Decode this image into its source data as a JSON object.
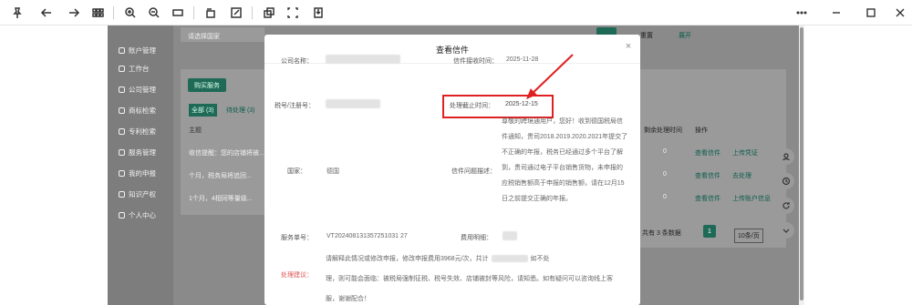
{
  "toolbar": {
    "icons": [
      "pin-icon",
      "back-icon",
      "forward-icon",
      "grid-icon",
      "zoom-in-icon",
      "zoom-out-icon",
      "fit-icon",
      "rotate-icon",
      "edit-icon",
      "copy-icon",
      "select-icon",
      "save-icon"
    ],
    "window_controls": [
      "more-icon",
      "minimize-icon",
      "maximize-icon",
      "close-icon"
    ]
  },
  "sidebar": {
    "items": [
      {
        "label": "账户管理"
      },
      {
        "label": "工作台"
      },
      {
        "label": "公司管理"
      },
      {
        "label": "商标检索"
      },
      {
        "label": "专利检索"
      },
      {
        "label": "服务管理"
      },
      {
        "label": "我的申报"
      },
      {
        "label": "知识产权"
      },
      {
        "label": "个人中心"
      }
    ]
  },
  "background": {
    "search_placeholder": "请选择国家",
    "reset_label": "重置",
    "expand_label": "展开",
    "buy_button": "购买服务",
    "tabs": [
      "全部 (3)",
      "待处理 (3)"
    ],
    "row_header": "主题",
    "rows": [
      "收信提醒：您的店铺将被...",
      "个月，税务局将追回...",
      "1个月，4相同等量级..."
    ],
    "col_headers": [
      "剩余处理时间",
      "操作"
    ],
    "row_counts": [
      "0",
      "0",
      "0"
    ],
    "actions": [
      "查看信件",
      "上传凭证",
      "查看信件",
      "去处理",
      "查看信件",
      "上传账户信息"
    ],
    "pager": {
      "total": "共有 3 条数据",
      "page": "1",
      "size": "10条/页"
    }
  },
  "modal": {
    "title": "查看信件",
    "fields": {
      "company_label": "公司名称：",
      "receive_time_label": "信件接收时间：",
      "receive_time": "2025-11-28",
      "tax_label": "税号/注册号：",
      "deadline_label": "处理截止时间：",
      "deadline": "2025-12-15",
      "country_label": "国家：",
      "country": "德国",
      "problem_label": "信件问题描述：",
      "problem_lines": [
        "尊敬的跨境通用户，您好！收到德国税局信",
        "件通知，贵司2018.2019.2020.2021年提交了",
        "不正确的年报，税务已经通过多个平台了解",
        "到，贵司通过电子平台销售货物，未申报的",
        "应税销售额高于申报的销售额，请在12月15",
        "日之前提交正确的年报。"
      ],
      "order_label": "服务单号：",
      "order_no": "VT202408131357251031 27",
      "fee_label": "费用明细：",
      "advice_label": "处理建议：",
      "advice_lines": [
        "请解释此情况或修改申报，修改申报费用3968元/次，共计",
        "理，则可能会面临：被税局强制征税、税号失效、店铺被封等风险，请知悉。如有疑问可以咨询线上客",
        "服，谢谢配合！"
      ],
      "advice_tail": "如不处"
    }
  },
  "colors": {
    "accent": "#1f6a57",
    "highlight": "#e02020"
  }
}
